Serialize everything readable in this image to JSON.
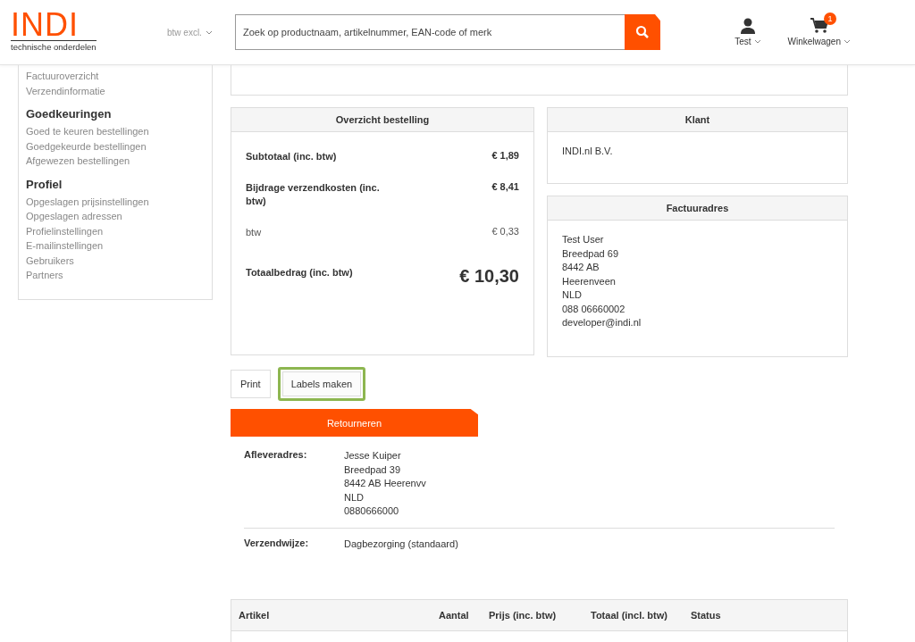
{
  "header": {
    "logo": "INDI",
    "logo_tagline": "technische onderdelen",
    "price_toggle": "btw excl.",
    "search": {
      "placeholder": "Zoek op productnaam, artikelnummer, EAN-code of merk"
    },
    "account": "Test",
    "cart": {
      "label": "Winkelwagen",
      "count": "1"
    }
  },
  "sidebar": {
    "groups": [
      {
        "items": [
          "Factuuroverzicht",
          "Verzendinformatie"
        ]
      },
      {
        "heading": "Goedkeuringen",
        "items": [
          "Goed te keuren bestellingen",
          "Goedgekeurde bestellingen",
          "Afgewezen bestellingen"
        ]
      },
      {
        "heading": "Profiel",
        "items": [
          "Opgeslagen prijsinstellingen",
          "Opgeslagen adressen",
          "Profielinstellingen",
          "E-mailinstellingen",
          "Gebruikers",
          "Partners"
        ]
      }
    ]
  },
  "order_summary": {
    "title": "Overzicht bestelling",
    "rows": [
      {
        "kind": "bold",
        "label": "Subtotaal (inc. btw)",
        "value": "€ 1,89"
      },
      {
        "kind": "bold",
        "label": "Bijdrage verzendkosten (inc. btw)",
        "value": "€ 8,41"
      },
      {
        "kind": "plain",
        "label": "btw",
        "value": "€ 0,33"
      },
      {
        "kind": "total",
        "label": "Totaalbedrag (inc. btw)",
        "value": "€ 10,30"
      }
    ]
  },
  "customer": {
    "title": "Klant",
    "lines": [
      "INDI.nl B.V."
    ]
  },
  "billing_address": {
    "title": "Factuuradres",
    "lines": [
      "Test User",
      "Breedpad 69",
      "8442 AB",
      "Heerenveen",
      "NLD",
      "088 06660002",
      "developer@indi.nl"
    ]
  },
  "actions": [
    {
      "label": "Print",
      "selected": false
    },
    {
      "label": "Labels maken",
      "selected": true
    }
  ],
  "return_button": "Retourneren",
  "shipping": [
    {
      "label": "Afleveradres:",
      "lines": [
        "Jesse Kuiper",
        "Breedpad 39",
        "8442 AB Heerenvv",
        "NLD",
        "0880666000"
      ]
    },
    {
      "label": "Verzendwijze:",
      "lines": [
        "Dagbezorging (standaard)"
      ]
    }
  ],
  "items_table": {
    "columns": [
      "Artikel",
      "Aantal",
      "Prijs (inc. btw)",
      "Totaal (incl. btw)",
      "Status"
    ]
  }
}
